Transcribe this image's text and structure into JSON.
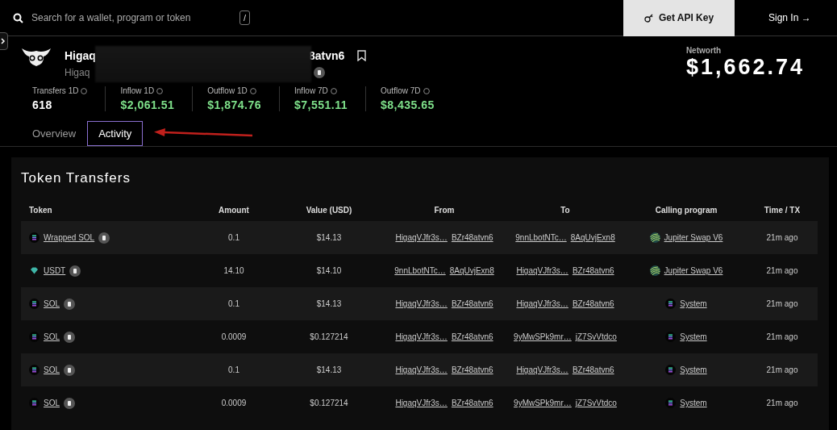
{
  "search": {
    "placeholder": "Search for a wallet, program or token",
    "shortcut": "/"
  },
  "nav": {
    "api_button": "Get API Key",
    "sign_in": "Sign In →"
  },
  "account": {
    "name_start": "Higaq",
    "name_end": "8atvn6",
    "address_start": "Higaq"
  },
  "networth": {
    "label": "Networth",
    "value": "$1,662.74"
  },
  "stats": [
    {
      "label": "Transfers 1D",
      "value": "618",
      "kind": "count"
    },
    {
      "label": "Inflow 1D",
      "value": "$2,061.51",
      "kind": "flow"
    },
    {
      "label": "Outflow 1D",
      "value": "$1,874.76",
      "kind": "flow"
    },
    {
      "label": "Inflow 7D",
      "value": "$7,551.11",
      "kind": "flow"
    },
    {
      "label": "Outflow 7D",
      "value": "$8,435.65",
      "kind": "flow"
    }
  ],
  "tabs": [
    {
      "label": "Overview",
      "selected": false
    },
    {
      "label": "Activity",
      "selected": true
    }
  ],
  "transfers": {
    "title": "Token Transfers",
    "columns": [
      "Token",
      "Amount",
      "Value (USD)",
      "From",
      "To",
      "Calling program",
      "Time / TX"
    ],
    "rows": [
      {
        "token": {
          "label": "Wrapped SOL",
          "kind": "sol"
        },
        "amount": "0.1",
        "value": "$14.13",
        "from": [
          "HigaqVJfr3s…",
          "BZr48atvn6"
        ],
        "to": [
          "9nnLbotNTc…",
          "8AqUvjExn8"
        ],
        "program": {
          "label": "Jupiter Swap V6",
          "kind": "jupiter"
        },
        "time": "21m ago"
      },
      {
        "token": {
          "label": "USDT",
          "kind": "usdt"
        },
        "amount": "14.10",
        "value": "$14.10",
        "from": [
          "9nnLbotNTc…",
          "8AqUvjExn8"
        ],
        "to": [
          "HigaqVJfr3s…",
          "BZr48atvn6"
        ],
        "program": {
          "label": "Jupiter Swap V6",
          "kind": "jupiter"
        },
        "time": "21m ago"
      },
      {
        "token": {
          "label": "SOL",
          "kind": "sol"
        },
        "amount": "0.1",
        "value": "$14.13",
        "from": [
          "HigaqVJfr3s…",
          "BZr48atvn6"
        ],
        "to": [
          "HigaqVJfr3s…",
          "BZr48atvn6"
        ],
        "program": {
          "label": "System",
          "kind": "system"
        },
        "time": "21m ago"
      },
      {
        "token": {
          "label": "SOL",
          "kind": "sol"
        },
        "amount": "0.0009",
        "value": "$0.127214",
        "from": [
          "HigaqVJfr3s…",
          "BZr48atvn6"
        ],
        "to": [
          "9yMwSPk9mr…",
          "jZ7SvVtdco"
        ],
        "program": {
          "label": "System",
          "kind": "system"
        },
        "time": "21m ago"
      },
      {
        "token": {
          "label": "SOL",
          "kind": "sol"
        },
        "amount": "0.1",
        "value": "$14.13",
        "from": [
          "HigaqVJfr3s…",
          "BZr48atvn6"
        ],
        "to": [
          "HigaqVJfr3s…",
          "BZr48atvn6"
        ],
        "program": {
          "label": "System",
          "kind": "system"
        },
        "time": "21m ago"
      },
      {
        "token": {
          "label": "SOL",
          "kind": "sol"
        },
        "amount": "0.0009",
        "value": "$0.127214",
        "from": [
          "HigaqVJfr3s…",
          "BZr48atvn6"
        ],
        "to": [
          "9yMwSPk9mr…",
          "jZ7SvVtdco"
        ],
        "program": {
          "label": "System",
          "kind": "system"
        },
        "time": "21m ago"
      }
    ]
  }
}
